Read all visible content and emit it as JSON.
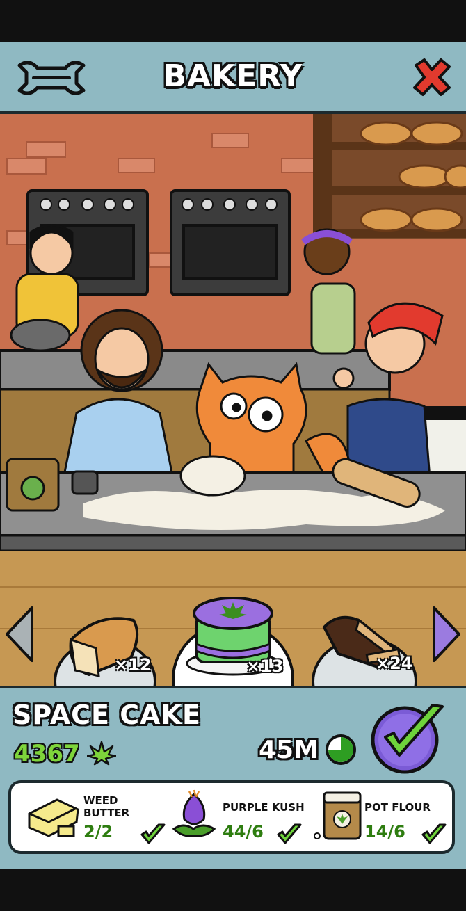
{
  "header": {
    "title": "BAKERY",
    "settings_icon": "wrench-icon",
    "close_icon": "close-x-icon"
  },
  "products": [
    {
      "name": "bread-loaf",
      "quantity": "×12"
    },
    {
      "name": "space-cake",
      "quantity": "×13",
      "selected": true
    },
    {
      "name": "chocolate-loaf",
      "quantity": "×24"
    }
  ],
  "recipe": {
    "name": "SPACE CAKE",
    "price": "4367",
    "price_icon": "weed-leaf-icon",
    "time": "45M",
    "time_icon": "timer-pie-icon"
  },
  "ingredients": [
    {
      "name_line1": "WEED",
      "name_line2": "BUTTER",
      "count": "2/2",
      "icon": "butter-icon"
    },
    {
      "name_line1": "PURPLE KUSH",
      "name_line2": "",
      "count": "44/6",
      "icon": "purple-kush-icon"
    },
    {
      "name_line1": "POT FLOUR",
      "name_line2": "",
      "count": "14/6",
      "icon": "flour-bag-icon"
    }
  ],
  "colors": {
    "panel": "#8fb9c2",
    "accent_green": "#7ed43b",
    "confirm_purple": "#7b5bd6",
    "wall": "#c9704e"
  }
}
